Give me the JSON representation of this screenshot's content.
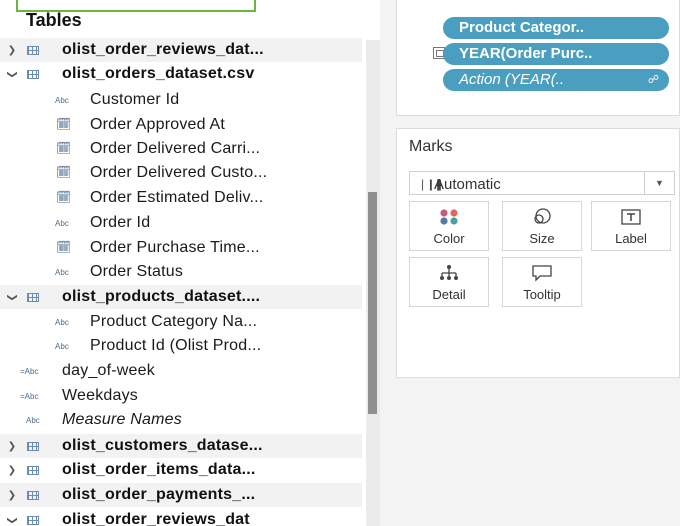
{
  "data_pane": {
    "heading": "Tables",
    "rows": [
      {
        "kind": "table",
        "expanded": false,
        "name": "olist_order_reviews_dat..."
      },
      {
        "kind": "table",
        "expanded": true,
        "name": "olist_orders_dataset.csv"
      },
      {
        "kind": "field",
        "type": "Abc",
        "name": "Customer Id"
      },
      {
        "kind": "field",
        "type": "date",
        "name": "Order Approved At"
      },
      {
        "kind": "field",
        "type": "date",
        "name": "Order Delivered Carri..."
      },
      {
        "kind": "field",
        "type": "date",
        "name": "Order Delivered Custo..."
      },
      {
        "kind": "field",
        "type": "date",
        "name": "Order Estimated Deliv..."
      },
      {
        "kind": "field",
        "type": "Abc",
        "name": "Order Id"
      },
      {
        "kind": "field",
        "type": "date",
        "name": "Order Purchase Time..."
      },
      {
        "kind": "field",
        "type": "Abc",
        "name": "Order Status"
      },
      {
        "kind": "table",
        "expanded": true,
        "name": "olist_products_dataset...."
      },
      {
        "kind": "field",
        "type": "Abc",
        "name": "Product Category Na..."
      },
      {
        "kind": "field",
        "type": "Abc",
        "name": "Product Id (Olist Prod..."
      },
      {
        "kind": "calc",
        "type": "=Abc",
        "name": "day_of-week"
      },
      {
        "kind": "calc",
        "type": "=Abc",
        "name": "Weekdays"
      },
      {
        "kind": "measure",
        "type": "Abc",
        "name": "Measure Names"
      },
      {
        "kind": "table",
        "expanded": false,
        "name": "olist_customers_datase..."
      },
      {
        "kind": "table",
        "expanded": false,
        "name": "olist_order_items_data..."
      },
      {
        "kind": "table",
        "expanded": false,
        "name": "olist_order_payments_..."
      },
      {
        "kind": "table",
        "expanded": true,
        "name": "olist_order_reviews_dat"
      }
    ]
  },
  "filters": {
    "pills": [
      {
        "label": "Product Categor..",
        "italic": false
      },
      {
        "label": "YEAR(Order Purc..",
        "italic": false
      },
      {
        "label": "Action (YEAR(..",
        "italic": true,
        "link_icon": "link-icon"
      }
    ]
  },
  "marks": {
    "title": "Marks",
    "mark_type": "Automatic",
    "buttons": {
      "color": "Color",
      "size": "Size",
      "label": "Label",
      "detail": "Detail",
      "tooltip": "Tooltip"
    }
  },
  "colors": {
    "pill": "#4a9fc1",
    "selection_outline": "#6cb33f",
    "table_icon": "#6b8db5",
    "scrollbar_thumb": "#8f8f8f"
  }
}
